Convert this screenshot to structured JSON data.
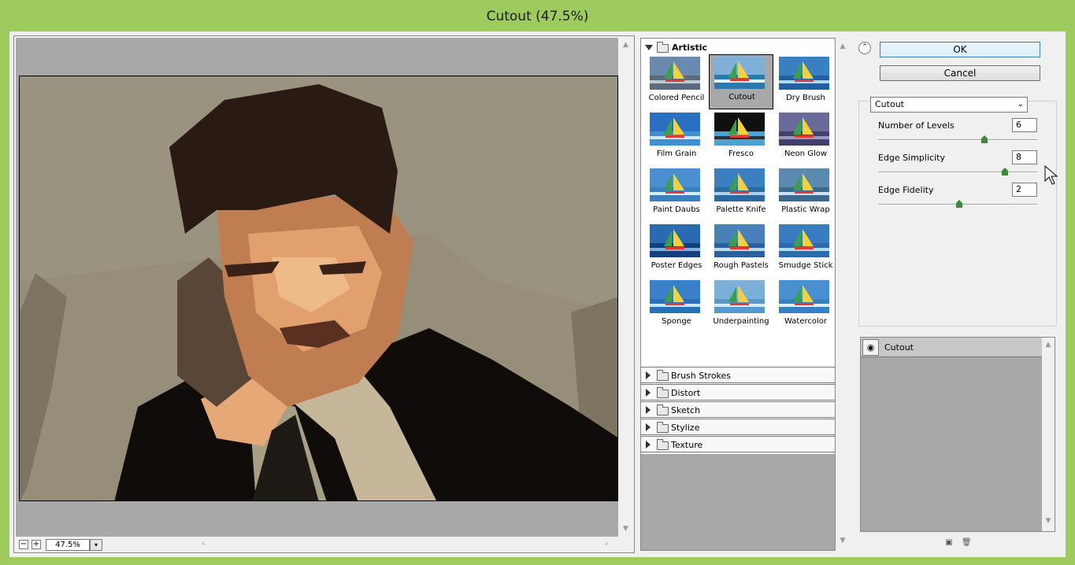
{
  "window": {
    "title": "Cutout (47.5%)"
  },
  "preview": {
    "zoom_value": "47.5%",
    "zoom_out_label": "−",
    "zoom_in_label": "+",
    "dropdown_arrow": "▾"
  },
  "gallery": {
    "open_category": "Artistic",
    "filters": [
      {
        "label": "Colored Pencil"
      },
      {
        "label": "Cutout"
      },
      {
        "label": "Dry Brush"
      },
      {
        "label": "Film Grain"
      },
      {
        "label": "Fresco"
      },
      {
        "label": "Neon Glow"
      },
      {
        "label": "Paint Daubs"
      },
      {
        "label": "Palette Knife"
      },
      {
        "label": "Plastic Wrap"
      },
      {
        "label": "Poster Edges"
      },
      {
        "label": "Rough Pastels"
      },
      {
        "label": "Smudge Stick"
      },
      {
        "label": "Sponge"
      },
      {
        "label": "Underpainting"
      },
      {
        "label": "Watercolor"
      }
    ],
    "selected_filter": "Cutout",
    "categories": [
      {
        "label": "Brush Strokes"
      },
      {
        "label": "Distort"
      },
      {
        "label": "Sketch"
      },
      {
        "label": "Stylize"
      },
      {
        "label": "Texture"
      }
    ]
  },
  "buttons": {
    "ok": "OK",
    "cancel": "Cancel",
    "collapse_symbol": "⌃"
  },
  "settings": {
    "filter_select": "Cutout",
    "params": [
      {
        "label": "Number of Levels",
        "value": "6",
        "min": 2,
        "max": 8
      },
      {
        "label": "Edge Simplicity",
        "value": "8",
        "min": 0,
        "max": 10
      },
      {
        "label": "Edge Fidelity",
        "value": "2",
        "min": 1,
        "max": 3
      }
    ]
  },
  "layers": {
    "items": [
      {
        "name": "Cutout",
        "visible": true
      }
    ]
  },
  "colors": {
    "frame": "#9dcb5e",
    "panel": "#f0f0f0",
    "gray": "#a8a8a8",
    "slider_knob": "#3a8a3a"
  },
  "icons": {
    "new_layer": "new-effect-layer-icon",
    "delete_layer": "delete-effect-layer-icon",
    "eye": "eye-icon"
  }
}
